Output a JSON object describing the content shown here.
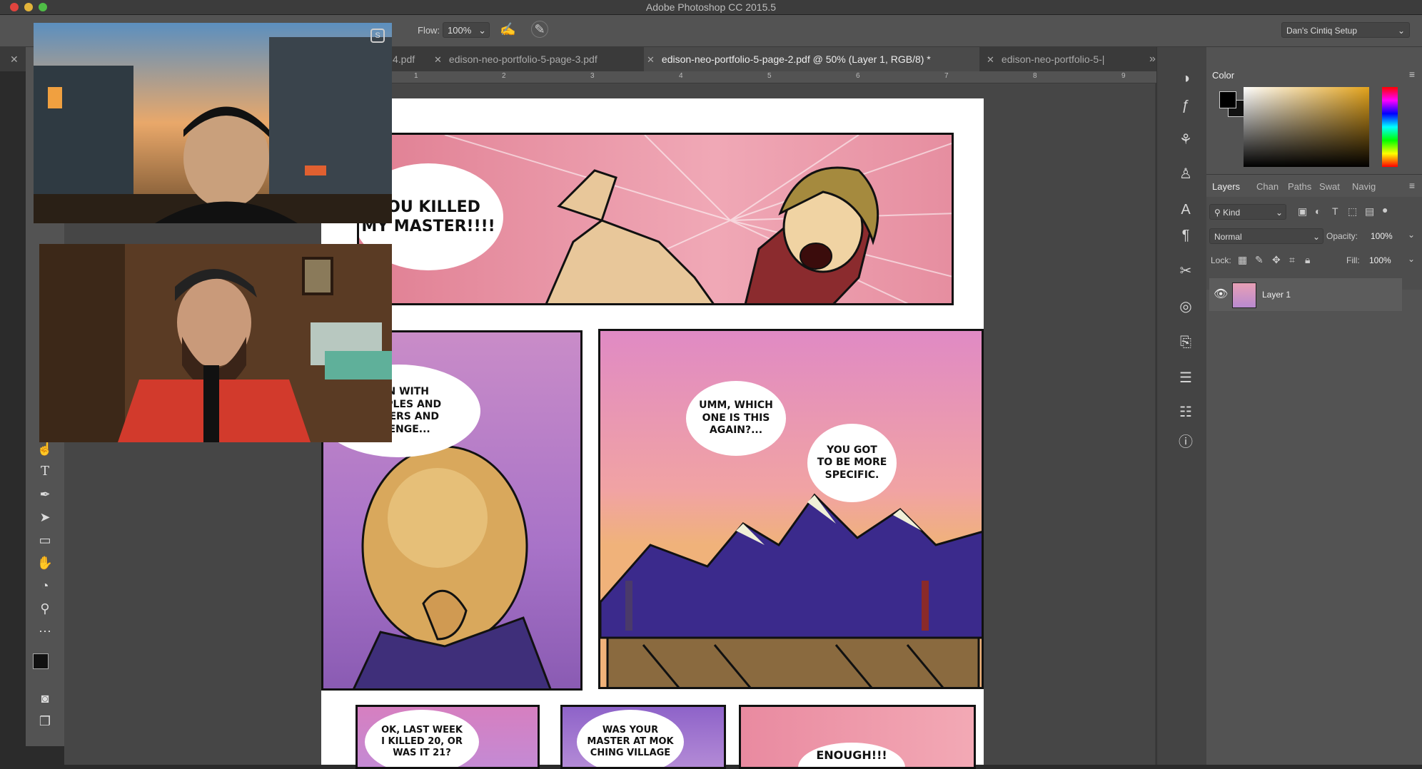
{
  "window": {
    "title": "Adobe Photoshop CC 2015.5"
  },
  "options_bar": {
    "flow_label": "Flow:",
    "flow_value": "100%",
    "workspace": "Dan's Cintiq Setup"
  },
  "tabs": [
    {
      "label": "4.pdf",
      "active": false
    },
    {
      "label": "edison-neo-portfolio-5-page-3.pdf",
      "active": false
    },
    {
      "label": "edison-neo-portfolio-5-page-2.pdf @ 50% (Layer 1, RGB/8) *",
      "active": true
    },
    {
      "label": "edison-neo-portfolio-5-|",
      "active": false
    }
  ],
  "ruler": {
    "ticks": [
      "1",
      "2",
      "3",
      "4",
      "5",
      "6",
      "7",
      "8",
      "9"
    ]
  },
  "comic": {
    "panel1_bubble": "YOU KILLED\nMY MASTER!!!!",
    "panel2_bubble": "GAIN WITH\nDISCIPLES AND\nMASTERS AND\nREVENGE...",
    "panel3_bubble_a": "UMM, WHICH\nONE IS THIS\nAGAIN?...",
    "panel3_bubble_b": "YOU GOT\nTO BE MORE\nSPECIFIC.",
    "panel4_bubble": "OK, LAST WEEK\nI KILLED 20, OR\nWAS IT 21?",
    "panel5_bubble": "WAS YOUR\nMASTER AT MOK\nCHING VILLAGE",
    "panel6_bubble": "ENOUGH!!!"
  },
  "color_panel": {
    "title": "Color"
  },
  "layers_panel": {
    "tabs": [
      "Layers",
      "Chan",
      "Paths",
      "Swat",
      "Navig"
    ],
    "filter": "Kind",
    "blend_mode": "Normal",
    "opacity_label": "Opacity:",
    "opacity_value": "100%",
    "lock_label": "Lock:",
    "fill_label": "Fill:",
    "fill_value": "100%",
    "layers": [
      {
        "name": "Layer 1",
        "visible": true
      }
    ]
  },
  "icons": {
    "colors": {
      "accent_red": "#e0443e",
      "yellow": "#e2b33a",
      "green": "#4fbd46"
    }
  }
}
